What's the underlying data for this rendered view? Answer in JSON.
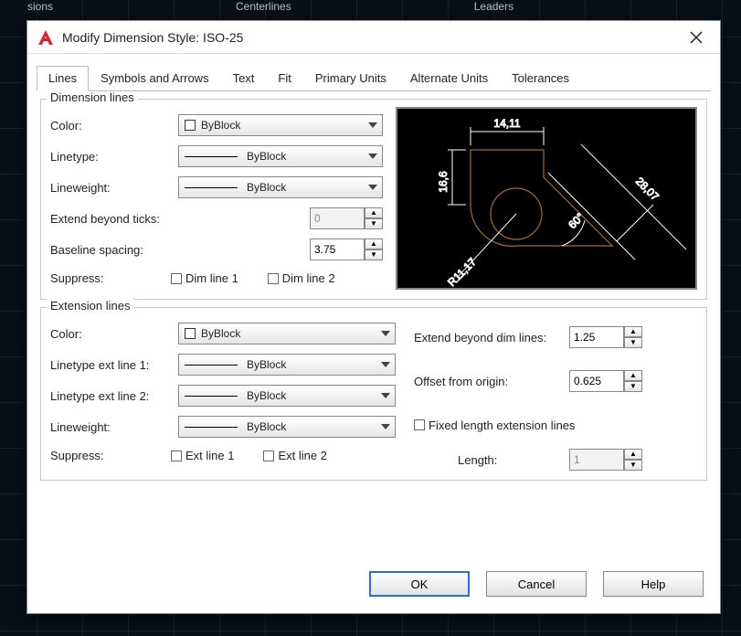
{
  "background_ribbon": {
    "item1": "sions",
    "item2": "Centerlines",
    "item3": "Leaders"
  },
  "window": {
    "title": "Modify Dimension Style: ISO-25",
    "close_icon": "close"
  },
  "tabs": {
    "items": [
      {
        "label": "Lines",
        "active": true
      },
      {
        "label": "Symbols and Arrows",
        "active": false
      },
      {
        "label": "Text",
        "active": false
      },
      {
        "label": "Fit",
        "active": false
      },
      {
        "label": "Primary Units",
        "active": false
      },
      {
        "label": "Alternate Units",
        "active": false
      },
      {
        "label": "Tolerances",
        "active": false
      }
    ]
  },
  "dimension_lines": {
    "legend": "Dimension lines",
    "color_label": "Color:",
    "color_value": "ByBlock",
    "linetype_label": "Linetype:",
    "linetype_value": "ByBlock",
    "lineweight_label": "Lineweight:",
    "lineweight_value": "ByBlock",
    "extend_ticks_label": "Extend beyond ticks:",
    "extend_ticks_value": "0",
    "baseline_spacing_label": "Baseline spacing:",
    "baseline_spacing_value": "3.75",
    "suppress_label": "Suppress:",
    "suppress_dim1": "Dim line 1",
    "suppress_dim2": "Dim line 2"
  },
  "extension_lines": {
    "legend": "Extension lines",
    "color_label": "Color:",
    "color_value": "ByBlock",
    "lt_ext1_label": "Linetype ext line 1:",
    "lt_ext1_value": "ByBlock",
    "lt_ext2_label": "Linetype ext line 2:",
    "lt_ext2_value": "ByBlock",
    "lineweight_label": "Lineweight:",
    "lineweight_value": "ByBlock",
    "suppress_label": "Suppress:",
    "suppress_ext1": "Ext line 1",
    "suppress_ext2": "Ext line 2",
    "extend_beyond_label": "Extend beyond dim lines:",
    "extend_beyond_value": "1.25",
    "offset_origin_label": "Offset from origin:",
    "offset_origin_value": "0.625",
    "fixed_length_label": "Fixed length extension lines",
    "length_label": "Length:",
    "length_value": "1"
  },
  "preview": {
    "dim_top": "14,11",
    "dim_left": "16,6",
    "dim_right": "28,07",
    "dim_radius": "R11,17",
    "dim_angle": "60°"
  },
  "footer": {
    "ok": "OK",
    "cancel": "Cancel",
    "help": "Help"
  }
}
